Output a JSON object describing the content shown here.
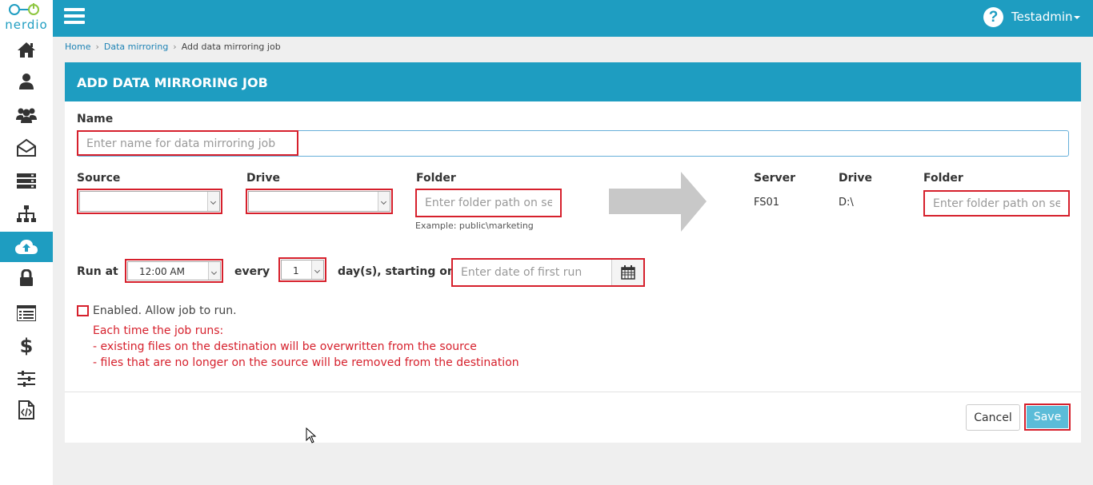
{
  "app": {
    "logo_text": "nerdio",
    "brand_color": "#1e9dc1",
    "accent_red": "#d6202c"
  },
  "sidebar": {
    "items": [
      {
        "icon": "home-icon"
      },
      {
        "icon": "user-icon"
      },
      {
        "icon": "users-group-icon"
      },
      {
        "icon": "envelope-open-icon"
      },
      {
        "icon": "server-stack-icon"
      },
      {
        "icon": "sitemap-icon"
      },
      {
        "icon": "cloud-upload-icon",
        "active": true
      },
      {
        "icon": "lock-icon"
      },
      {
        "icon": "list-icon"
      },
      {
        "icon": "dollar-icon"
      },
      {
        "icon": "sliders-icon"
      },
      {
        "icon": "code-file-icon"
      }
    ]
  },
  "topbar": {
    "user_name": "Testadmin"
  },
  "breadcrumb": {
    "home": "Home",
    "section": "Data mirroring",
    "current": "Add data mirroring job",
    "separator": "›"
  },
  "form": {
    "title": "ADD DATA MIRRORING JOB",
    "name_label": "Name",
    "name_placeholder": "Enter name for data mirroring job",
    "source": {
      "source_label": "Source",
      "drive_label": "Drive",
      "folder_label": "Folder",
      "folder_placeholder": "Enter folder path on ser",
      "folder_example": "Example: public\\marketing"
    },
    "destination": {
      "server_label": "Server",
      "drive_label": "Drive",
      "folder_label": "Folder",
      "server_value": "FS01",
      "drive_value": "D:\\",
      "folder_placeholder": "Enter folder path on ser"
    },
    "schedule": {
      "run_at_label": "Run at",
      "run_at_value": "12:00 AM",
      "every_label": "every",
      "every_value": "1",
      "days_label": "day(s), starting on",
      "date_placeholder": "Enter date of first run"
    },
    "enabled_label": "Enabled. Allow job to run.",
    "warning_lines": [
      "Each time the job runs:",
      "- existing files on the destination will be overwritten from the source",
      "- files that are no longer on the source will be removed from the destination"
    ],
    "cancel_label": "Cancel",
    "save_label": "Save"
  }
}
